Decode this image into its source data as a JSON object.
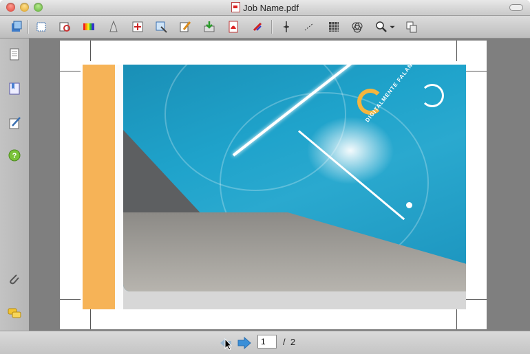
{
  "window": {
    "title": "Job Name.pdf"
  },
  "toolbar": {
    "icons": [
      "layers-icon",
      "crop-marks-icon",
      "print-preview-icon",
      "color-bars-icon",
      "ink-icon",
      "registration-icon",
      "trim-icon",
      "edit-pen-icon",
      "export-icon",
      "pdf-icon",
      "separations-icon",
      "fit-icon",
      "measure-icon",
      "grid-icon",
      "overprint-icon",
      "zoom-icon",
      "compare-icon"
    ]
  },
  "sidebar": {
    "icons": [
      "pages-icon",
      "bookmarks-icon",
      "signature-icon",
      "help-icon",
      "attachments-icon",
      "comments-icon"
    ]
  },
  "artwork": {
    "brand_text": "DIGITALMENTE FALANDO"
  },
  "pager": {
    "current_page": "1",
    "separator": "/",
    "total_pages": "2"
  },
  "colors": {
    "accent_blue": "#1fa3cb",
    "accent_orange": "#f6b357"
  }
}
